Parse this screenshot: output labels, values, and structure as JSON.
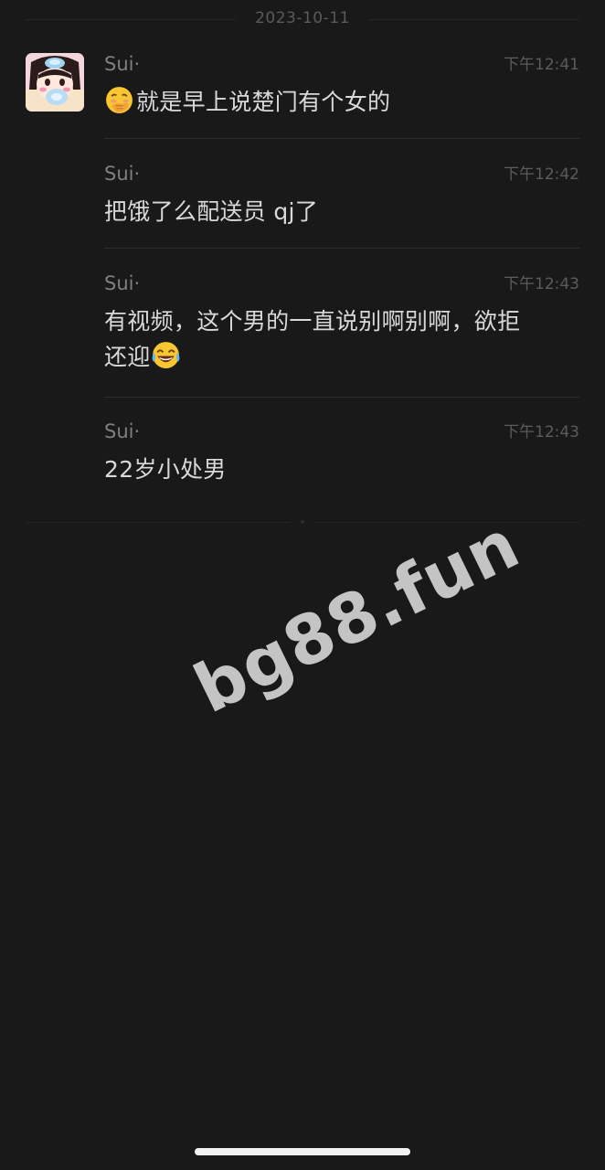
{
  "chat": {
    "date_separator": "2023-10-11",
    "messages": [
      {
        "sender": "Sui·",
        "time": "下午12:41",
        "emoji": "face-with-hand-over-mouth-emoji",
        "text": "就是早上说楚门有个女的"
      },
      {
        "sender": "Sui·",
        "time": "下午12:42",
        "text": "把饿了么配送员 qj了"
      },
      {
        "sender": "Sui·",
        "time": "下午12:43",
        "text_line1": "有视频，这个男的一直说别啊别啊，欲拒",
        "text_line2": "还迎",
        "emoji": "tears-of-joy-emoji"
      },
      {
        "sender": "Sui·",
        "time": "下午12:43",
        "text": "22岁小处男"
      }
    ]
  },
  "watermark": "bg88.fun",
  "colors": {
    "background": "#191919",
    "message_text": "#d9d9d9",
    "sender_text": "#7f7f7f",
    "time_text": "#5c5c5c",
    "divider": "#2b2b2b",
    "watermark": "#c4c4c4",
    "home_indicator": "#f2f2f2"
  }
}
